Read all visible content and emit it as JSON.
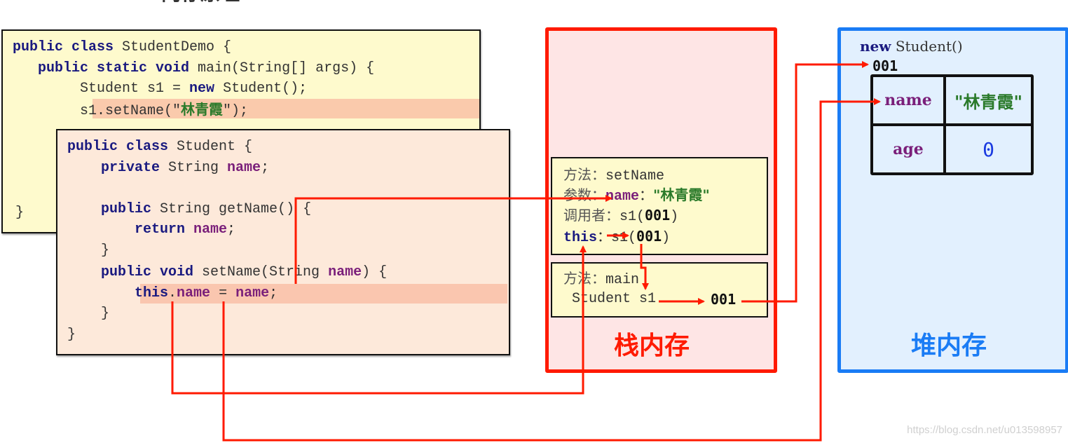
{
  "title_partial": "内存原理",
  "demo_code": {
    "lines": [
      {
        "parts": [
          {
            "t": "public class ",
            "c": "kw"
          },
          {
            "t": "StudentDemo {",
            "c": ""
          }
        ]
      },
      {
        "parts": [
          {
            "t": "   public static void ",
            "c": "kw"
          },
          {
            "t": "main(String[] args) {",
            "c": ""
          }
        ]
      },
      {
        "parts": [
          {
            "t": "        Student s1 = ",
            "c": ""
          },
          {
            "t": "new",
            "c": "kw"
          },
          {
            "t": " Student();",
            "c": ""
          }
        ]
      },
      {
        "parts": [
          {
            "t": "        s1.setName(\"",
            "c": ""
          },
          {
            "t": "林青霞",
            "c": "str"
          },
          {
            "t": "\");",
            "c": ""
          }
        ]
      },
      {
        "parts": [
          {
            "t": "}",
            "c": ""
          }
        ]
      }
    ]
  },
  "student_code": {
    "lines": [
      {
        "parts": [
          {
            "t": "public class ",
            "c": "kw"
          },
          {
            "t": "Student {",
            "c": ""
          }
        ]
      },
      {
        "parts": [
          {
            "t": "    private",
            "c": "kw"
          },
          {
            "t": " String ",
            "c": ""
          },
          {
            "t": "name",
            "c": "var"
          },
          {
            "t": ";",
            "c": ""
          }
        ]
      },
      {
        "parts": [
          {
            "t": "",
            "c": ""
          }
        ]
      },
      {
        "parts": [
          {
            "t": "    public",
            "c": "kw"
          },
          {
            "t": " String getName() {",
            "c": ""
          }
        ]
      },
      {
        "parts": [
          {
            "t": "        return ",
            "c": "kw"
          },
          {
            "t": "name",
            "c": "var"
          },
          {
            "t": ";",
            "c": ""
          }
        ]
      },
      {
        "parts": [
          {
            "t": "    }",
            "c": ""
          }
        ]
      },
      {
        "parts": [
          {
            "t": "    public void ",
            "c": "kw"
          },
          {
            "t": "setName(String ",
            "c": ""
          },
          {
            "t": "name",
            "c": "var"
          },
          {
            "t": ") {",
            "c": ""
          }
        ]
      },
      {
        "parts": [
          {
            "t": "        this",
            "c": "kw"
          },
          {
            "t": ".",
            "c": ""
          },
          {
            "t": "name",
            "c": "var"
          },
          {
            "t": " = ",
            "c": ""
          },
          {
            "t": "name",
            "c": "var"
          },
          {
            "t": ";",
            "c": ""
          }
        ]
      },
      {
        "parts": [
          {
            "t": "    }",
            "c": ""
          }
        ]
      },
      {
        "parts": [
          {
            "t": "}",
            "c": ""
          }
        ]
      }
    ]
  },
  "stack": {
    "label": "栈内存",
    "color": "#ff1a00",
    "frame_setname": {
      "method_label": "方法：",
      "method_name": "setName",
      "param_label": "参数：",
      "param_name": "name",
      "param_sep": "：",
      "param_value": "\"林青霞\"",
      "caller_label": "调用者：",
      "caller_var": "s1(",
      "caller_addr": "001",
      "caller_close": ")",
      "this_label": "this",
      "this_sep": "：",
      "this_var": "s1(",
      "this_addr": "001",
      "this_close": ")"
    },
    "frame_main": {
      "method_label": "方法：",
      "method_name": "main",
      "var_decl": "Student s1",
      "var_value": "001"
    }
  },
  "heap": {
    "label": "堆内存",
    "color": "#1a7cf5",
    "new_keyword": "new",
    "new_class": "Student()",
    "address": "001",
    "fields": [
      {
        "name": "name",
        "value": "\"林青霞\""
      },
      {
        "name": "age",
        "value": "0"
      }
    ]
  },
  "watermark": "https://blog.csdn.net/u013598957"
}
